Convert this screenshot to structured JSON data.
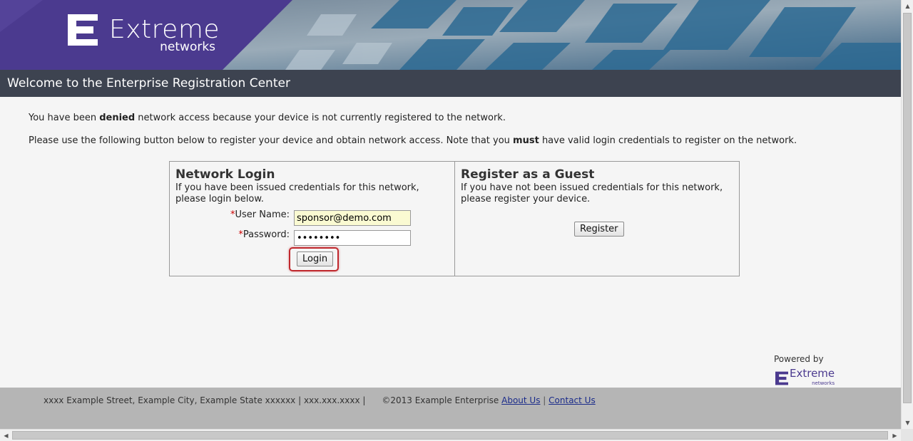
{
  "brand": {
    "name": "Extreme",
    "sub": "networks",
    "accent": "#4b3a8f"
  },
  "header": {
    "title": "Welcome to the Enterprise Registration Center"
  },
  "messages": {
    "line1_pre": "You have been ",
    "line1_bold": "denied",
    "line1_post": " network access because your device is not currently registered to the network.",
    "line2_pre": "Please use the following button below to register your device and obtain network access. Note that you ",
    "line2_bold": "must",
    "line2_post": " have valid login credentials to register on the network."
  },
  "login": {
    "heading": "Network Login",
    "description": "If you have been issued credentials for this network, please login below.",
    "required_mark": "*",
    "username_label": "User Name:",
    "username_value": "sponsor@demo.com",
    "password_label": "Password:",
    "password_value": "••••••••",
    "button": "Login"
  },
  "guest": {
    "heading": "Register as a Guest",
    "description": "If you have not been issued credentials for this network, please register your device.",
    "button": "Register"
  },
  "powered": {
    "label": "Powered by",
    "brand": "Extreme",
    "sub": "networks"
  },
  "footer": {
    "address": "xxxx Example Street, Example City, Example State xxxxxx | xxx.xxx.xxxx |",
    "copyright": "©2013 Example Enterprise",
    "about": "About Us",
    "separator": "|",
    "contact": "Contact Us"
  },
  "scrollbar": {
    "up_glyph": "▲",
    "down_glyph": "▼",
    "left_glyph": "◀",
    "right_glyph": "▶"
  }
}
